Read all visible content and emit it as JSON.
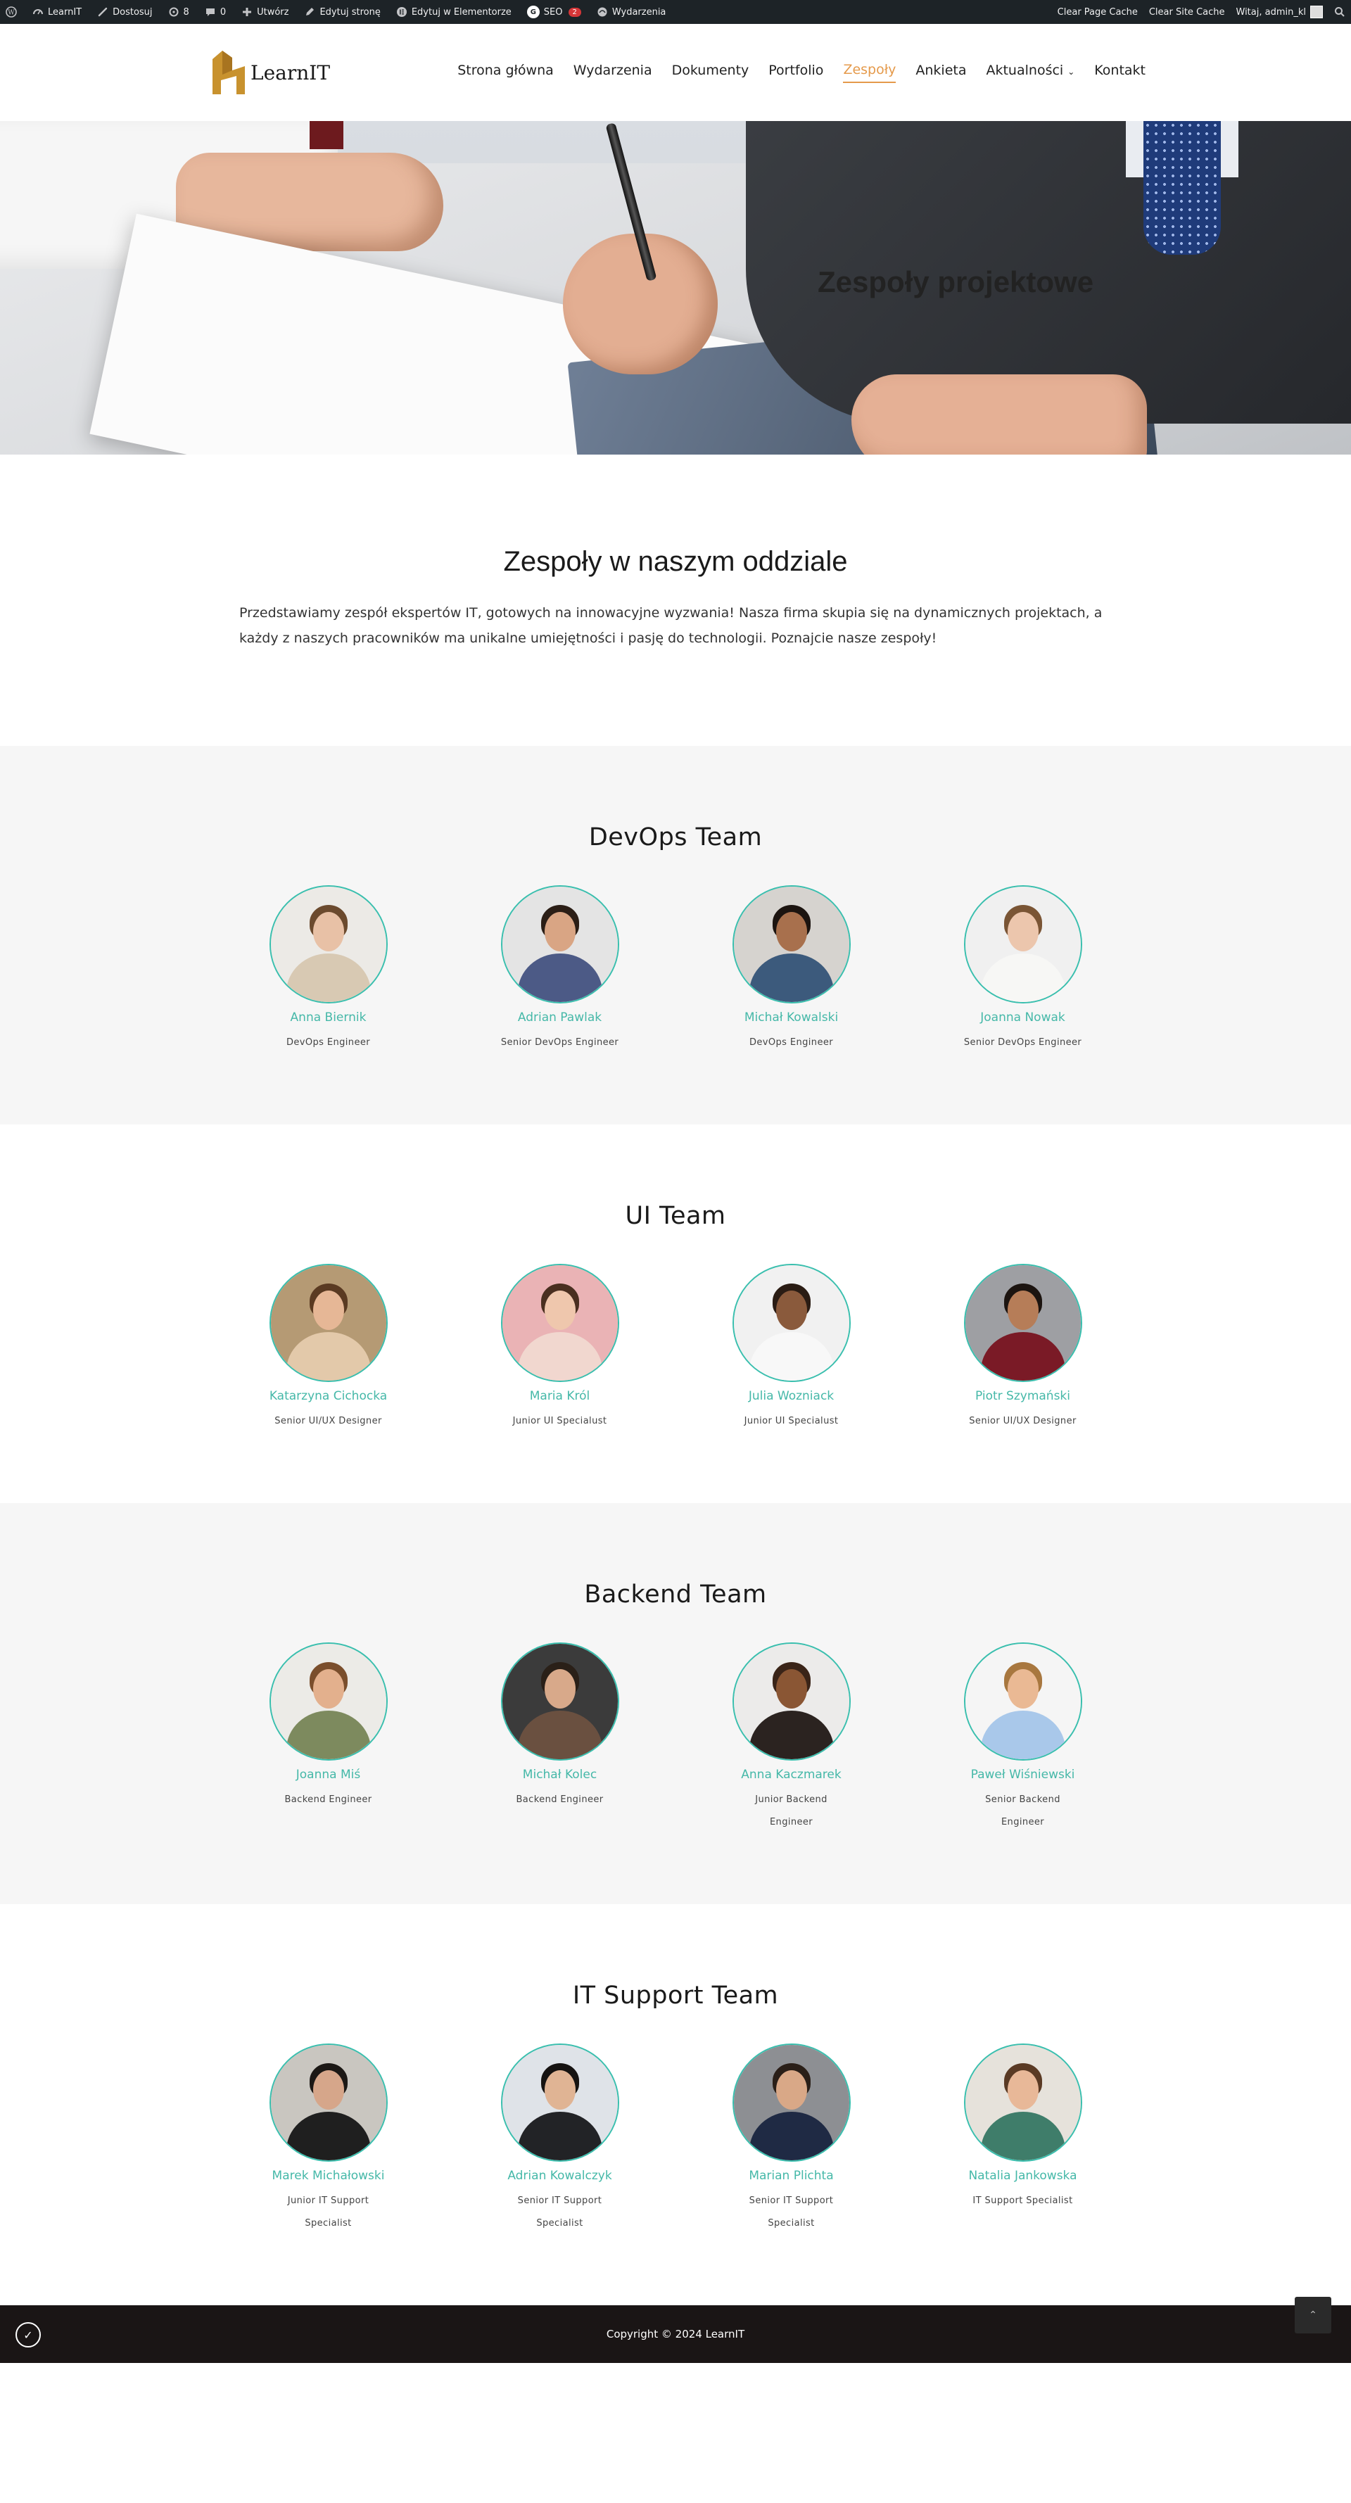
{
  "adminbar": {
    "items": [
      {
        "icon": "wordpress-icon",
        "label": ""
      },
      {
        "icon": "dashboard-icon",
        "label": "LearnIT"
      },
      {
        "icon": "brush-icon",
        "label": "Dostosuj"
      },
      {
        "icon": "updates-icon",
        "label": "8"
      },
      {
        "icon": "comment-icon",
        "label": "0"
      },
      {
        "icon": "plus-icon",
        "label": "Utwórz"
      },
      {
        "icon": "pencil-icon",
        "label": "Edytuj stronę"
      },
      {
        "icon": "elementor-icon",
        "label": "Edytuj w Elementorze"
      },
      {
        "icon": "seo-icon",
        "label": "SEO",
        "badge": "2"
      },
      {
        "icon": "events-icon",
        "label": "Wydarzenia"
      }
    ],
    "right": {
      "clear_page_cache": "Clear Page Cache",
      "clear_site_cache": "Clear Site Cache",
      "greeting": "Witaj, admin_kl"
    }
  },
  "header": {
    "logo_text": "LearnIT",
    "nav": [
      {
        "label": "Strona główna",
        "active": false
      },
      {
        "label": "Wydarzenia",
        "active": false
      },
      {
        "label": "Dokumenty",
        "active": false
      },
      {
        "label": "Portfolio",
        "active": false
      },
      {
        "label": "Zespoły",
        "active": true
      },
      {
        "label": "Ankieta",
        "active": false
      },
      {
        "label": "Aktualności",
        "active": false,
        "dropdown": true
      },
      {
        "label": "Kontakt",
        "active": false
      }
    ]
  },
  "hero": {
    "title": "Zespoły projektowe"
  },
  "intro": {
    "title": "Zespoły w naszym oddziale",
    "text": "Przedstawiamy zespół ekspertów IT, gotowych na innowacyjne wyzwania! Nasza firma skupia się na dynamicznych projektach, a każdy z naszych pracowników ma unikalne umiejętności i pasję do technologii. Poznajcie nasze zespoły!"
  },
  "teams": [
    {
      "title": "DevOps Team",
      "members": [
        {
          "name": "Anna Biernik",
          "role": "DevOps Engineer"
        },
        {
          "name": "Adrian Pawlak",
          "role": "Senior DevOps Engineer"
        },
        {
          "name": "Michał Kowalski",
          "role": "DevOps Engineer"
        },
        {
          "name": "Joanna Nowak",
          "role": "Senior DevOps Engineer"
        }
      ]
    },
    {
      "title": "UI Team",
      "members": [
        {
          "name": "Katarzyna Cichocka",
          "role": "Senior UI/UX Designer"
        },
        {
          "name": "Maria Król",
          "role": "Junior UI Specialust"
        },
        {
          "name": "Julia Wozniack",
          "role": "Junior UI Specialust"
        },
        {
          "name": "Piotr Szymański",
          "role": "Senior UI/UX Designer"
        }
      ]
    },
    {
      "title": "Backend Team",
      "members": [
        {
          "name": "Joanna Miś",
          "role": "Backend Engineer"
        },
        {
          "name": "Michał Kolec",
          "role": "Backend Engineer"
        },
        {
          "name": "Anna Kaczmarek",
          "role": "Junior Backend Engineer"
        },
        {
          "name": "Paweł Wiśniewski",
          "role": "Senior Backend Engineer"
        }
      ]
    },
    {
      "title": "IT Support Team",
      "members": [
        {
          "name": "Marek Michałowski",
          "role": "Junior IT Support Specialist"
        },
        {
          "name": "Adrian Kowalczyk",
          "role": "Senior IT Support Specialist"
        },
        {
          "name": "Marian Plichta",
          "role": "Senior IT Support Specialist"
        },
        {
          "name": "Natalia Jankowska",
          "role": "IT Support Specialist"
        }
      ]
    }
  ],
  "footer": {
    "copyright": "Copyright © 2024 LearnIT"
  },
  "colors": {
    "accent": "#45b8a8",
    "nav_active": "#e59a4b",
    "logo_gold": "#c8922e"
  }
}
